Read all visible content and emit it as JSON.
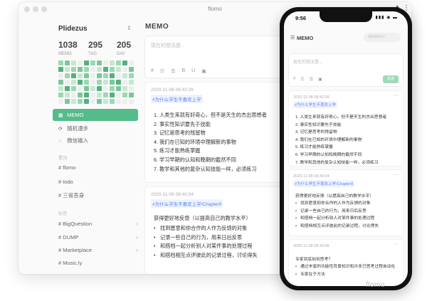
{
  "window": {
    "title": "flomo"
  },
  "sidebar": {
    "username": "Plidezus",
    "stats": [
      {
        "value": "1038",
        "label": "MEMO"
      },
      {
        "value": "295",
        "label": "TAG"
      },
      {
        "value": "205",
        "label": "DAY"
      }
    ],
    "nav": [
      {
        "label": "MEMO",
        "icon": "grid-icon"
      },
      {
        "label": "随机漫步",
        "icon": "shuffle-icon"
      },
      {
        "label": "微信输入",
        "icon": "wechat-icon"
      }
    ],
    "pinned_label": "置顶",
    "pinned_tags": [
      "# flomo",
      "# todo",
      "# 三省吾身"
    ],
    "all_tags_label": "标签",
    "tags": [
      "# BigQuestion",
      "# DUMP",
      "# Marketplace",
      "# Music.ly"
    ],
    "heatmap_colors": {
      "empty": "#eeeeee",
      "level1": "#c5e8d2",
      "level2": "#9dd7b3",
      "level3": "#7cc79a",
      "level4": "#55b17e"
    }
  },
  "main": {
    "title": "MEMO",
    "editor_placeholder": "现在的想法是...",
    "editor_tools": [
      "#",
      "☷",
      "☰",
      "B",
      "U",
      "▣"
    ],
    "memos": [
      {
        "time": "2020-11-08 08:42:26",
        "tag": "#为什么学生不喜欢上学",
        "lines": [
          "1. 人类生来就有好奇心，但不是天生的杰出思想者",
          "2. 事实性知识要先于技能",
          "3. 记忆是思考的残留物",
          "4. 我们在已知的环境中理解新的事物",
          "5. 练习才能熟练掌握",
          "6. 学习早期的认知和晚期的截然不同",
          "7. 教学和其他的复杂认知技能一样，必须练习"
        ]
      },
      {
        "time": "2020-11-08 08:40:04",
        "tag": "#为什么学生不喜欢上学/Chapter9",
        "intro": "获得更好地反馈（以提高自己的教学水平）",
        "bullets": [
          "找到愿意和你合作的人作为反馈的对象",
          "记录一些自己的行为，用来日后反思",
          "和搭档一起分析别人对某件事的处理过程",
          "和搭档相互点评彼此的记录过程，讨论得失"
        ]
      }
    ]
  },
  "phone": {
    "status_time": "9:56",
    "status_icons": "▮▮▮ ◉ ▬",
    "title": "MEMO",
    "search_placeholder": "SEARCH",
    "editor_placeholder": "现在的想法是...",
    "editor_tools": [
      "#",
      "☷",
      "☰",
      "▣"
    ],
    "send_label": "发送",
    "memos": [
      {
        "time": "2020-11-08 08:42:26",
        "tag": "#为什么学生不喜欢上学",
        "lines": [
          "1. 人类生来就有好奇心，但不是天生的杰出思想者",
          "2. 事实性知识要先于技能",
          "3. 记忆是思考的残留物",
          "4. 我们在已知的环境中理解新的事物",
          "5. 练习才能熟练掌握",
          "6. 学习早期的认知和晚期的截然不同",
          "7. 教学和其他的复杂认知技能一样，必须练习"
        ]
      },
      {
        "time": "2020-11-08 08:40:04",
        "tag": "#为什么学生不喜欢上学/Chapter9",
        "intro": "获得更好地反馈（以提高自己的教学水平）",
        "bullets": [
          "找到愿意和你合作的人作为反馈的对象",
          "记录一些自己的行为，用来日后反思",
          "和搭档一起分析别人对某件事的处理过程",
          "和搭档相互点评彼此的记录过程，讨论得失"
        ]
      },
      {
        "time": "2020-11-08 08:30:06",
        "intro": "专家到底如何思考？",
        "bullets": [
          "通过丰富的功能性背景知识和许多已思考过程自动化",
          "专家在于方法"
        ]
      }
    ]
  },
  "watermark": "flomo"
}
